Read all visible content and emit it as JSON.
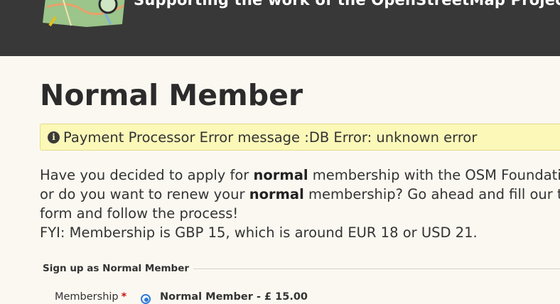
{
  "header": {
    "tagline": "Supporting the work of the OpenStreetMap Project",
    "logo_icon": "osm-magnifier-map-logo-icon"
  },
  "page": {
    "title": "Normal Member"
  },
  "alert": {
    "icon": "info-circle-icon",
    "message": "Payment Processor Error message :DB Error: unknown error"
  },
  "intro": {
    "l1_a": "Have you decided to apply for ",
    "l1_b": "normal",
    "l1_c": " membership with the OSM Foundation,",
    "l2_a": "or do you want to renew your ",
    "l2_b": "normal",
    "l2_c": " membership? Go ahead and fill our this",
    "l3": "form and follow the process!",
    "l4": "FYI: Membership is GBP 15, which is around EUR 18 or USD 21."
  },
  "form": {
    "legend": "Sign up as Normal Member",
    "membership_label": "Membership",
    "required_marker": "*",
    "option_label": "Normal Member - £ 15.00",
    "option_selected": true
  },
  "colors": {
    "header_bg": "#383838",
    "page_bg": "#fbf8f1",
    "alert_bg": "#fbf8b8",
    "required": "#cc1111",
    "radio_accent": "#2f7ad8"
  }
}
